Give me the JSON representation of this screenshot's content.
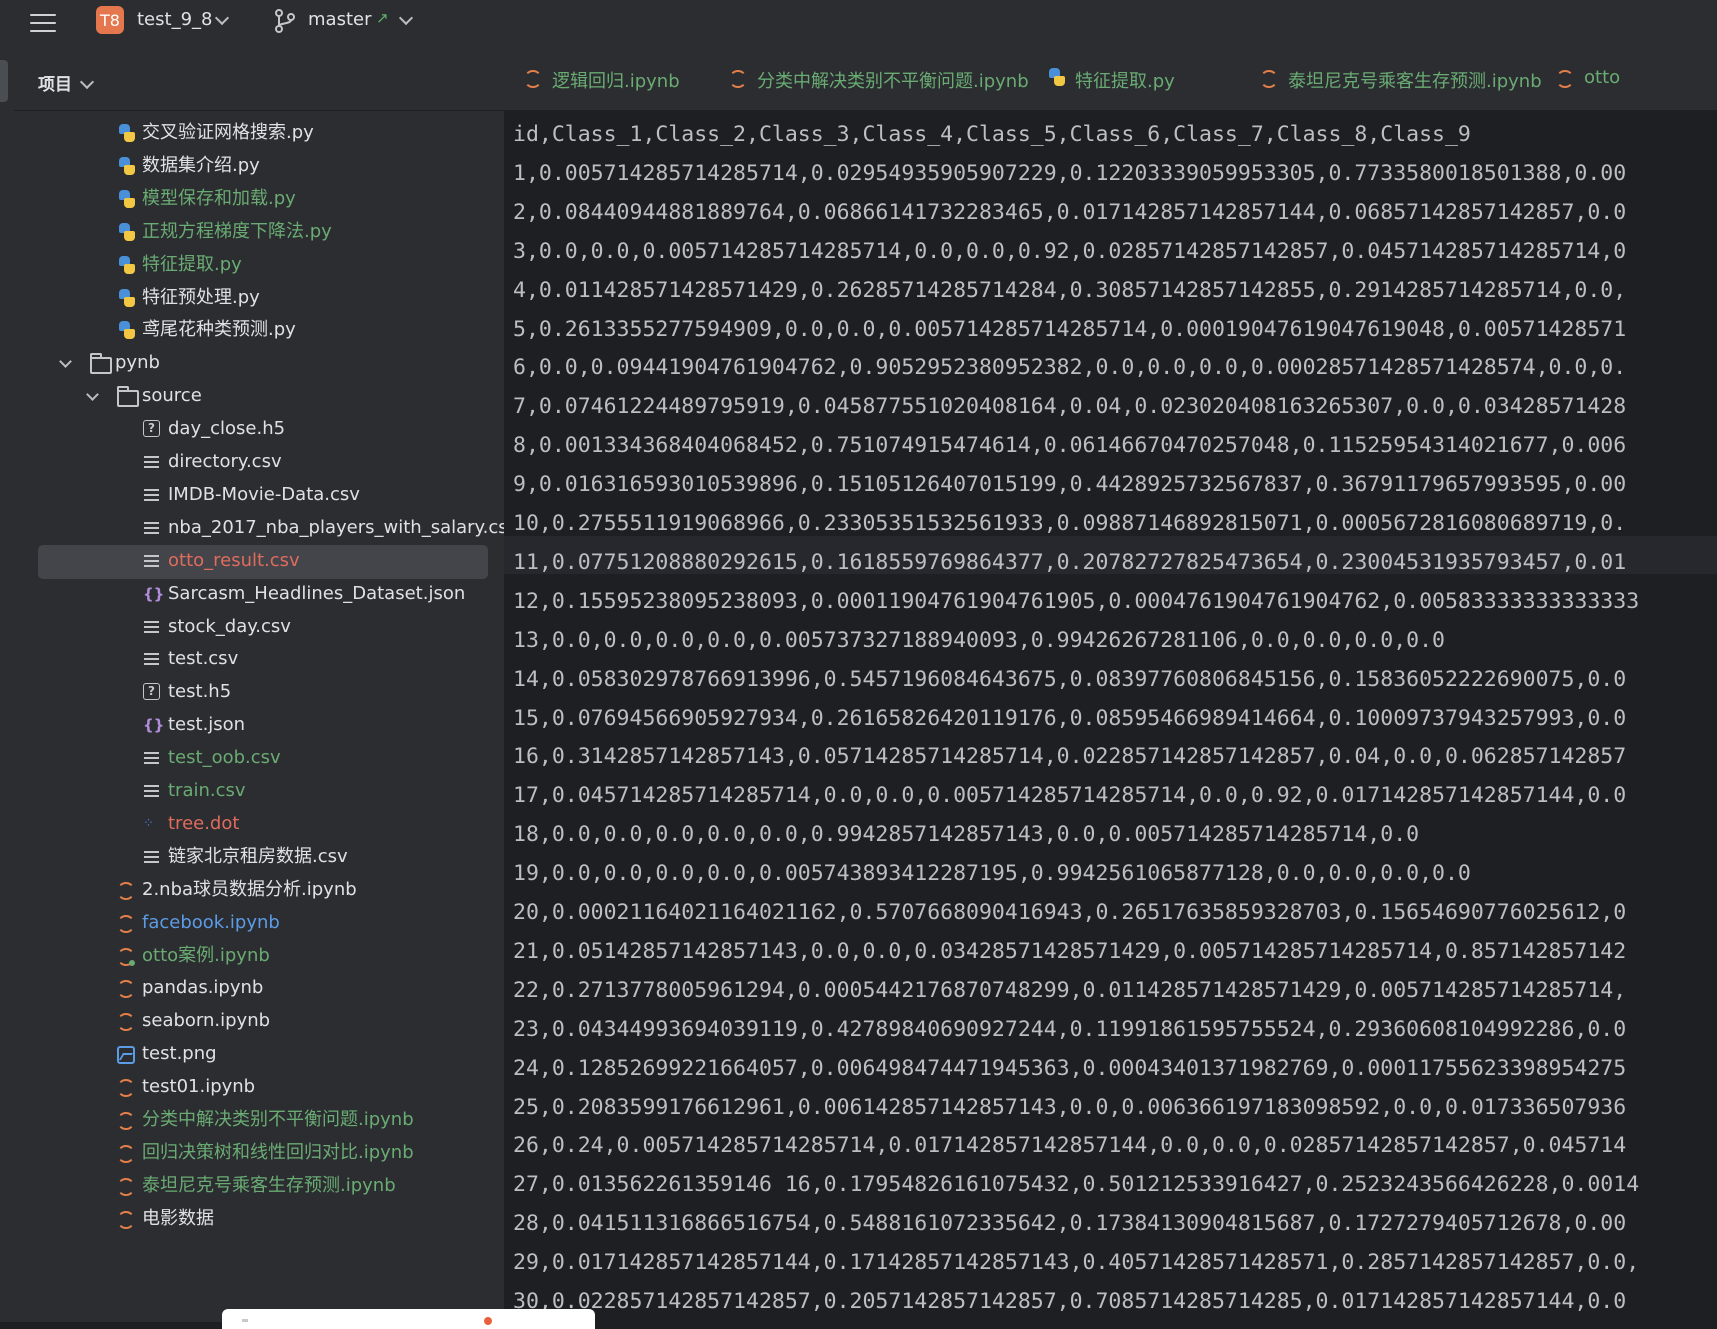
{
  "titlebar": {
    "project_badge": "T8",
    "project_name": "test_9_8",
    "branch_name": "master",
    "branch_arrow": "↗"
  },
  "sidebar": {
    "title": "项目",
    "items": [
      {
        "label": "交叉验证网格搜索.py",
        "icon": "python-file-icon",
        "color": "default"
      },
      {
        "label": "数据集介绍.py",
        "icon": "python-file-icon",
        "color": "default"
      },
      {
        "label": "模型保存和加载.py",
        "icon": "python-file-icon",
        "color": "green"
      },
      {
        "label": "正规方程梯度下降法.py",
        "icon": "python-file-icon",
        "color": "green"
      },
      {
        "label": "特征提取.py",
        "icon": "python-file-icon",
        "color": "green"
      },
      {
        "label": "特征预处理.py",
        "icon": "python-file-icon",
        "color": "default"
      },
      {
        "label": "鸢尾花种类预测.py",
        "icon": "python-file-icon",
        "color": "default"
      },
      {
        "label": "pynb",
        "icon": "folder-icon",
        "color": "default"
      },
      {
        "label": "source",
        "icon": "folder-icon",
        "color": "default"
      },
      {
        "label": "day_close.h5",
        "icon": "unknown-file-icon",
        "color": "default"
      },
      {
        "label": "directory.csv",
        "icon": "text-file-icon",
        "color": "default"
      },
      {
        "label": "IMDB-Movie-Data.csv",
        "icon": "text-file-icon",
        "color": "default"
      },
      {
        "label": "nba_2017_nba_players_with_salary.cs",
        "icon": "text-file-icon",
        "color": "default"
      },
      {
        "label": "otto_result.csv",
        "icon": "text-file-icon",
        "color": "red"
      },
      {
        "label": "Sarcasm_Headlines_Dataset.json",
        "icon": "json-file-icon",
        "color": "default"
      },
      {
        "label": "stock_day.csv",
        "icon": "text-file-icon",
        "color": "default"
      },
      {
        "label": "test.csv",
        "icon": "text-file-icon",
        "color": "default"
      },
      {
        "label": "test.h5",
        "icon": "unknown-file-icon",
        "color": "default"
      },
      {
        "label": "test.json",
        "icon": "json-file-icon",
        "color": "default"
      },
      {
        "label": "test_oob.csv",
        "icon": "text-file-icon",
        "color": "green"
      },
      {
        "label": "train.csv",
        "icon": "text-file-icon",
        "color": "green"
      },
      {
        "label": "tree.dot",
        "icon": "dot-file-icon",
        "color": "red"
      },
      {
        "label": "链家北京租房数据.csv",
        "icon": "text-file-icon",
        "color": "default"
      },
      {
        "label": "2.nba球员数据分析.ipynb",
        "icon": "notebook-icon",
        "color": "default"
      },
      {
        "label": "facebook.ipynb",
        "icon": "notebook-icon",
        "color": "blue"
      },
      {
        "label": "otto案例.ipynb",
        "icon": "notebook-icon",
        "color": "green"
      },
      {
        "label": "pandas.ipynb",
        "icon": "notebook-icon",
        "color": "default"
      },
      {
        "label": "seaborn.ipynb",
        "icon": "notebook-icon",
        "color": "default"
      },
      {
        "label": "test.png",
        "icon": "image-file-icon",
        "color": "default"
      },
      {
        "label": "test01.ipynb",
        "icon": "notebook-icon",
        "color": "default"
      },
      {
        "label": "分类中解决类别不平衡问题.ipynb",
        "icon": "notebook-icon",
        "color": "green"
      },
      {
        "label": "回归决策树和线性回归对比.ipynb",
        "icon": "notebook-icon",
        "color": "green"
      },
      {
        "label": "泰坦尼克号乘客生存预测.ipynb",
        "icon": "notebook-icon",
        "color": "green"
      },
      {
        "label": "电影数据",
        "icon": "notebook-icon",
        "color": "default"
      }
    ]
  },
  "tabs": [
    {
      "label": "逻辑回归.ipynb",
      "icon": "notebook-icon"
    },
    {
      "label": "分类中解决类别不平衡问题.ipynb",
      "icon": "notebook-icon"
    },
    {
      "label": "特征提取.py",
      "icon": "python-file-icon"
    },
    {
      "label": "泰坦尼克号乘客生存预测.ipynb",
      "icon": "notebook-icon"
    },
    {
      "label": "otto",
      "icon": "notebook-icon"
    }
  ],
  "editor": {
    "lines": [
      "id,Class_1,Class_2,Class_3,Class_4,Class_5,Class_6,Class_7,Class_8,Class_9",
      "1,0.005714285714285714,0.02954935905907229,0.12203339059953305,0.7733580018501388,0.00",
      "2,0.08440944881889764,0.06866141732283465,0.017142857142857144,0.06857142857142857,0.0",
      "3,0.0,0.0,0.005714285714285714,0.0,0.0,0.92,0.02857142857142857,0.045714285714285714,0",
      "4,0.011428571428571429,0.26285714285714284,0.30857142857142855,0.2914285714285714,0.0,",
      "5,0.2613355277594909,0.0,0.0,0.005714285714285714,0.00019047619047619048,0.00571428571",
      "6,0.0,0.09441904761904762,0.9052952380952382,0.0,0.0,0.0,0.00028571428571428574,0.0,0.",
      "7,0.07461224489795919,0.045877551020408164,0.04,0.023020408163265307,0.0,0.03428571428",
      "8,0.001334368404068452,0.751074915474614,0.06146670470257048,0.11525954314021677,0.006",
      "9,0.016316593010539896,0.15105126407015199,0.4428925732567837,0.36791179657993595,0.00",
      "10,0.2755511919068966,0.23305351532561933,0.09887146892815071,0.0005672816080689719,0.",
      "11,0.07751208880292615,0.1618559769864377,0.20782727825473654,0.23004531935793457,0.01",
      "12,0.15595238095238093,0.00011904761904761905,0.0004761904761904762,0.00583333333333333",
      "13,0.0,0.0,0.0,0.0,0.005737327188940093,0.99426267281106,0.0,0.0,0.0,0.0",
      "14,0.058302978766913996,0.5457196084643675,0.08397760806845156,0.15836052222690075,0.0",
      "15,0.07694566905927934,0.26165826420119176,0.08595466989414664,0.10009737943257993,0.0",
      "16,0.3142857142857143,0.05714285714285714,0.022857142857142857,0.04,0.0,0.062857142857",
      "17,0.045714285714285714,0.0,0.0,0.005714285714285714,0.0,0.92,0.017142857142857144,0.0",
      "18,0.0,0.0,0.0,0.0,0.0,0.9942857142857143,0.0,0.005714285714285714,0.0",
      "19,0.0,0.0,0.0,0.0,0.005743893412287195,0.9942561065877128,0.0,0.0,0.0,0.0",
      "20,0.00021164021164021162,0.5707668090416943,0.26517635859328703,0.15654690776025612,0",
      "21,0.05142857142857143,0.0,0.0,0.03428571428571429,0.005714285714285714,0.857142857142",
      "22,0.2713778005961294,0.0005442176870748299,0.011428571428571429,0.005714285714285714,",
      "23,0.04344993694039119,0.42789840690927244,0.11991861595755524,0.29360608104992286,0.0",
      "24,0.12852699221664057,0.006498474471945363,0.00043401371982769,0.00011755623398954275",
      "25,0.2083599176612961,0.006142857142857143,0.0,0.006366197183098592,0.0,0.017336507936",
      "26,0.24,0.005714285714285714,0.017142857142857144,0.0,0.0,0.02857142857142857,0.045714",
      "27,0.013562261359146 16,0.17954826161075432,0.501212533916427,0.2523243566426228,0.0014",
      "28,0.041511316866516754,0.5488161072335642,0.17384130904815687,0.1727279405712678,0.00",
      "29,0.017142857142857144,0.17142857142857143,0.40571428571428571,0.2857142857142857,0.0,",
      "30,0.022857142857142857,0.2057142857142857,0.7085714285714285,0.017142857142857144,0.0"
    ]
  },
  "colors": {
    "default": "#dfe1e5",
    "green": "#6aab73",
    "blue": "#5c9ce6",
    "red": "#e06c5d",
    "badge": "#e5774e"
  }
}
